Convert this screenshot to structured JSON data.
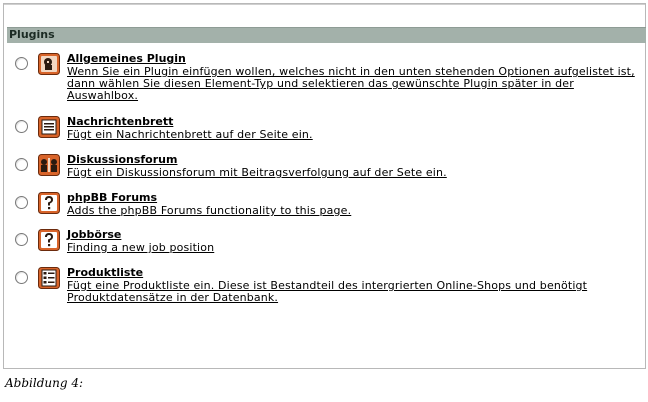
{
  "panel": {
    "header": "Plugins"
  },
  "plugins": [
    {
      "icon": "generic-plugin-icon",
      "title": "Allgemeines Plugin",
      "description": "Wenn Sie ein Plugin einfügen wollen, welches nicht in den unten stehenden Optionen aufgelistet ist, dann wählen Sie diesen Element-Typ und selektieren das gewünschte Plugin später in der Auswahlbox."
    },
    {
      "icon": "message-board-icon",
      "title": "Nachrichtenbrett",
      "description": "Fügt ein Nachrichtenbrett auf der Seite ein."
    },
    {
      "icon": "discussion-forum-icon",
      "title": "Diskussionsforum",
      "description": "Fügt ein Diskussionsforum mit Beitragsverfolgung auf der Sete ein."
    },
    {
      "icon": "question-mark-icon",
      "title": "phpBB Forums",
      "description": "Adds the phpBB Forums functionality to this page."
    },
    {
      "icon": "question-mark-icon",
      "title": "Jobbörse",
      "description": "Finding a new job position"
    },
    {
      "icon": "product-list-icon",
      "title": "Produktliste",
      "description": "Fügt eine Produktliste ein. Diese ist Bestandteil des intergrierten Online-Shops und benötigt Produktdatensätze in der Datenbank."
    }
  ],
  "caption": "Abbildung 4:",
  "colors": {
    "header_bg": "#a3b1aa",
    "icon_orange": "#d8642a",
    "icon_dark": "#2a1a10"
  }
}
